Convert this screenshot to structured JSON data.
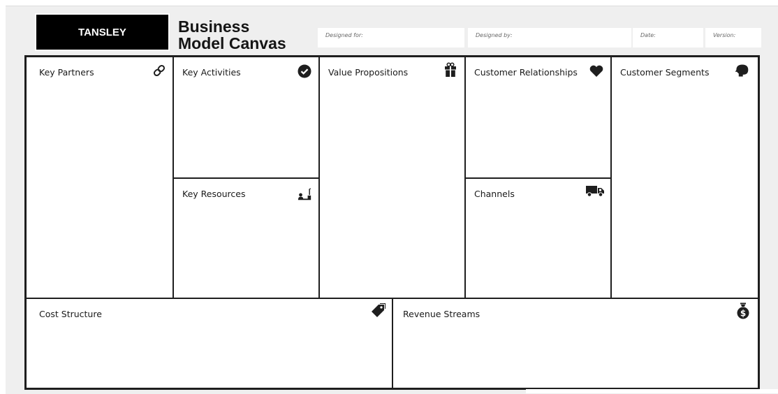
{
  "header": {
    "logo_text": "TANSLEY",
    "title_line1": "Business",
    "title_line2": "Model Canvas",
    "designed_for_label": "Designed for:",
    "designed_by_label": "Designed by:",
    "date_label": "Date:",
    "version_label": "Version:"
  },
  "canvas": {
    "key_partners": {
      "label": "Key Partners",
      "icon": "link-icon"
    },
    "key_activities": {
      "label": "Key Activities",
      "icon": "check-circle-icon"
    },
    "key_resources": {
      "label": "Key Resources",
      "icon": "worker-icon"
    },
    "value_propositions": {
      "label": "Value Propositions",
      "icon": "gift-icon"
    },
    "customer_relationships": {
      "label": "Customer Relationships",
      "icon": "heart-icon"
    },
    "channels": {
      "label": "Channels",
      "icon": "truck-icon"
    },
    "customer_segments": {
      "label": "Customer Segments",
      "icon": "head-icon"
    },
    "cost_structure": {
      "label": "Cost Structure",
      "icon": "tag-icon"
    },
    "revenue_streams": {
      "label": "Revenue Streams",
      "icon": "money-bag-icon"
    }
  },
  "colors": {
    "ink": "#1e1e1e",
    "background": "#efefef",
    "logo_bg": "#000000"
  }
}
